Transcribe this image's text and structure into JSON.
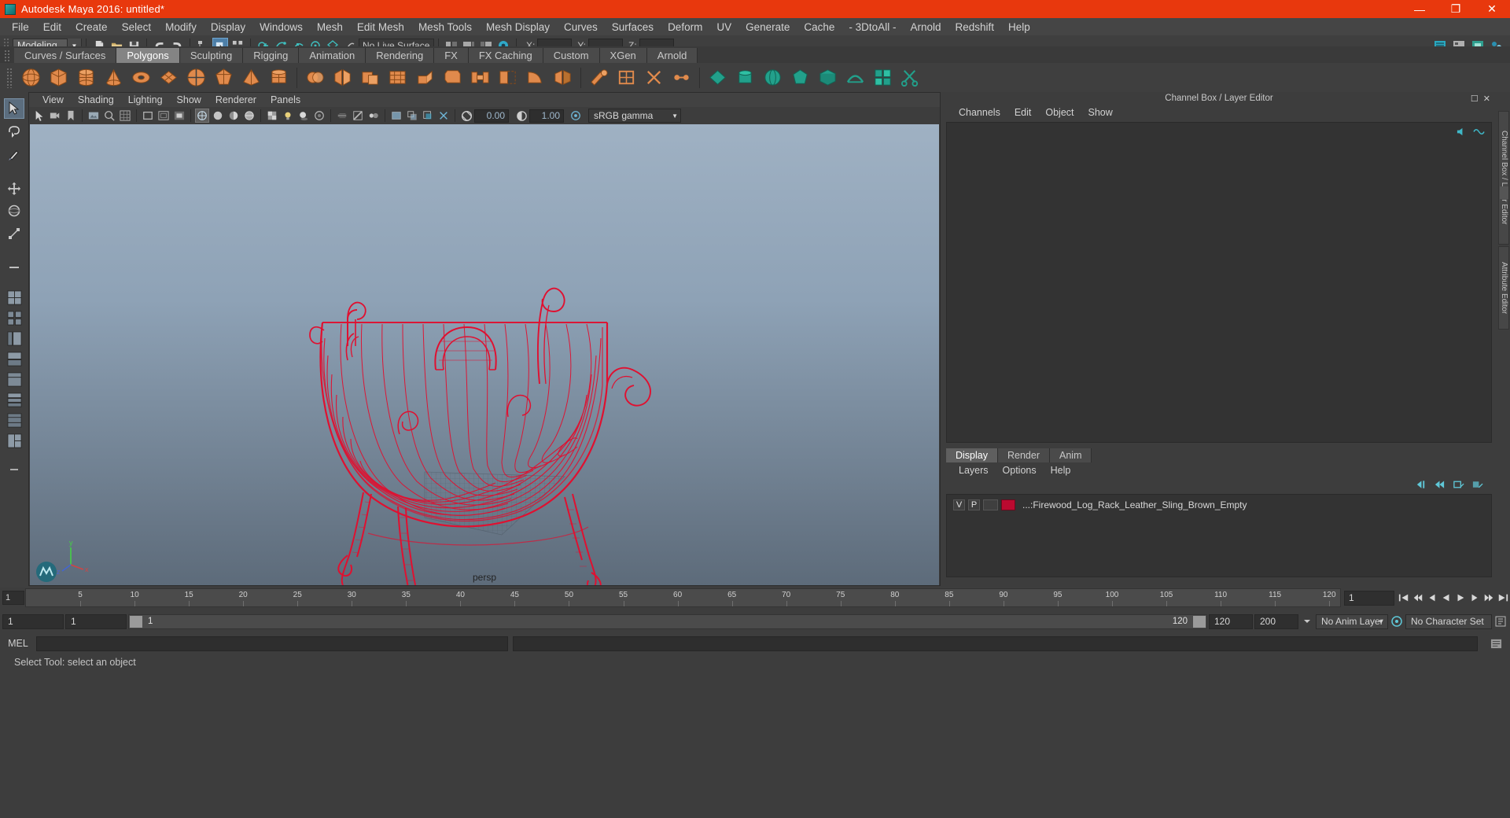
{
  "window": {
    "title": "Autodesk Maya 2016: untitled*",
    "app_icon": "maya-logo-icon",
    "buttons": [
      {
        "name": "minimize-button",
        "glyph": "—"
      },
      {
        "name": "maximize-button",
        "glyph": "❐"
      },
      {
        "name": "close-button",
        "glyph": "✕"
      }
    ],
    "titlebar_color": "#e8380d"
  },
  "menubar": {
    "items": [
      "File",
      "Edit",
      "Create",
      "Select",
      "Modify",
      "Display",
      "Windows",
      "Mesh",
      "Edit Mesh",
      "Mesh Tools",
      "Mesh Display",
      "Curves",
      "Surfaces",
      "Deform",
      "UV",
      "Generate",
      "Cache",
      "- 3DtoAll -",
      "Arnold",
      "Redshift",
      "Help"
    ]
  },
  "statusbar": {
    "mode": "Modeling",
    "live_surface": "No Live Surface",
    "coord_labels": [
      "X:",
      "Y:",
      "Z:"
    ],
    "coord_values": [
      "",
      "",
      ""
    ],
    "icons": [
      "new-scene-icon",
      "open-scene-icon",
      "save-scene-icon",
      "undo-icon",
      "redo-icon",
      "select-by-hierarchy-icon",
      "select-by-object-icon",
      "select-by-component-icon",
      "snap-to-grid-icon",
      "snap-to-curve-icon",
      "snap-to-point-icon",
      "snap-to-projected-center-icon",
      "snap-to-view-plane-icon",
      "make-live-icon",
      "show-hide-editors-icon"
    ]
  },
  "shelf": {
    "tabs": [
      "Curves / Surfaces",
      "Polygons",
      "Sculpting",
      "Rigging",
      "Animation",
      "Rendering",
      "FX",
      "FX Caching",
      "Custom",
      "XGen",
      "Arnold"
    ],
    "active_tab": "Polygons",
    "icons": [
      "poly-sphere-icon",
      "poly-cube-icon",
      "poly-cylinder-icon",
      "poly-cone-icon",
      "poly-torus-icon",
      "poly-plane-icon",
      "poly-disc-icon",
      "poly-platonic-icon",
      "poly-pyramid-icon",
      "poly-prism-icon",
      "poly-pipe-icon",
      "poly-helix-icon",
      "poly-soccer-ball-icon",
      "poly-super-ellipse-icon",
      "combine-icon",
      "separate-icon",
      "booleans-icon",
      "smooth-icon",
      "extrude-icon",
      "bevel-icon",
      "bridge-icon",
      "append-polygon-icon",
      "wedge-icon",
      "mirror-geometry-icon",
      "sculpt-geometry-icon",
      "quad-draw-icon",
      "multi-cut-icon",
      "target-weld-icon",
      "crease-icon",
      "delete-edge-icon"
    ],
    "icon_color": "#e08a4c",
    "tool_color": "#22a08b"
  },
  "toolbox": {
    "items": [
      "select-tool",
      "lasso-select-tool",
      "paint-select-tool",
      "move-tool",
      "rotate-tool",
      "scale-tool",
      "last-tool"
    ],
    "selected": "select-tool",
    "layouts": [
      "single-perspective-layout",
      "four-view-layout",
      "outliner-persp-layout",
      "persp-graph-layout",
      "hypershade-persp-layout",
      "persp-graph-hypergraph-layout",
      "two-pane-stacked-layout",
      "three-pane-split-layout"
    ]
  },
  "viewport": {
    "menus": [
      "View",
      "Shading",
      "Lighting",
      "Show",
      "Renderer",
      "Panels"
    ],
    "exposure_value": "0.00",
    "gamma_value": "1.00",
    "color_management": "sRGB gamma",
    "camera_label": "persp",
    "axis_labels": {
      "x": "x",
      "y": "y",
      "z": "z"
    },
    "wireframe_color": "#e01030",
    "background_top": "#9fb1c3",
    "background_bottom": "#5d6b7a",
    "model_name": "Firewood Log Rack Leather Sling Brown Empty wireframe",
    "toolbar_icons": [
      "select-tool-icon",
      "lasso-icon",
      "paint-select-icon",
      "move-icon",
      "rotate-icon",
      "scale-icon",
      "show-manipulator-icon",
      "grid-toggle-icon",
      "film-gate-icon",
      "resolution-gate-icon",
      "gate-mask-icon",
      "film-origin-icon",
      "two-dimensional-pan-zoom-icon",
      "use-all-lights-icon",
      "shadows-icon",
      "screen-space-ao-icon",
      "motion-blur-icon",
      "multisample-icon",
      "depth-of-field-icon",
      "xray-icon",
      "xray-joints-icon",
      "xray-active-components-icon",
      "exposure-icon",
      "gamma-icon"
    ]
  },
  "right_panel": {
    "header_title": "Channel Box / Layer Editor",
    "header_icons": [
      "undock-icon",
      "close-panel-icon"
    ],
    "channelbox_menus": [
      "Channels",
      "Edit",
      "Object",
      "Show"
    ],
    "channelbox_icons": [
      "speaker-icon",
      "wave-icon"
    ],
    "layer_tabs": [
      "Display",
      "Render",
      "Anim"
    ],
    "layer_active_tab": "Display",
    "layer_menus": [
      "Layers",
      "Options",
      "Help"
    ],
    "layer_tool_icons": [
      "layer-first-icon",
      "layer-prev-icon",
      "layer-new-icon",
      "layer-new-from-selected-icon"
    ],
    "layers": [
      {
        "visibility": "V",
        "playback": "P",
        "state": "",
        "color": "#bb0a30",
        "name": "...:Firewood_Log_Rack_Leather_Sling_Brown_Empty"
      }
    ],
    "vertical_tabs": [
      "Channel Box / Layer Editor",
      "Attribute Editor"
    ]
  },
  "timeline": {
    "start_label": "1",
    "ticks": [
      {
        "label": "5",
        "frame": 5
      },
      {
        "label": "10",
        "frame": 10
      },
      {
        "label": "15",
        "frame": 15
      },
      {
        "label": "20",
        "frame": 20
      },
      {
        "label": "25",
        "frame": 25
      },
      {
        "label": "30",
        "frame": 30
      },
      {
        "label": "35",
        "frame": 35
      },
      {
        "label": "40",
        "frame": 40
      },
      {
        "label": "45",
        "frame": 45
      },
      {
        "label": "50",
        "frame": 50
      },
      {
        "label": "55",
        "frame": 55
      },
      {
        "label": "60",
        "frame": 60
      },
      {
        "label": "65",
        "frame": 65
      },
      {
        "label": "70",
        "frame": 70
      },
      {
        "label": "75",
        "frame": 75
      },
      {
        "label": "80",
        "frame": 80
      },
      {
        "label": "85",
        "frame": 85
      },
      {
        "label": "90",
        "frame": 90
      },
      {
        "label": "95",
        "frame": 95
      },
      {
        "label": "100",
        "frame": 100
      },
      {
        "label": "105",
        "frame": 105
      },
      {
        "label": "110",
        "frame": 110
      },
      {
        "label": "115",
        "frame": 115
      },
      {
        "label": "120",
        "frame": 120
      }
    ],
    "current_frame": "1",
    "playback_buttons": [
      "go-to-start-icon",
      "step-back-keyframe-icon",
      "step-back-frame-icon",
      "play-backwards-icon",
      "play-forwards-icon",
      "step-forward-frame-icon",
      "step-forward-keyframe-icon",
      "go-to-end-icon"
    ]
  },
  "range_slider": {
    "anim_start": "1",
    "range_start": "1",
    "bar_left_label": "1",
    "bar_right_label": "120",
    "range_end": "120",
    "anim_end": "200",
    "anim_layer": "No Anim Layer",
    "character_set": "No Character Set",
    "auto_key_icon": "auto-keyframe-icon",
    "prefs_icon": "animation-preferences-icon"
  },
  "command_line": {
    "label": "MEL",
    "input_value": "",
    "output_value": "",
    "script_editor_icon": "script-editor-icon"
  },
  "help_line": {
    "text": "Select Tool: select an object"
  }
}
